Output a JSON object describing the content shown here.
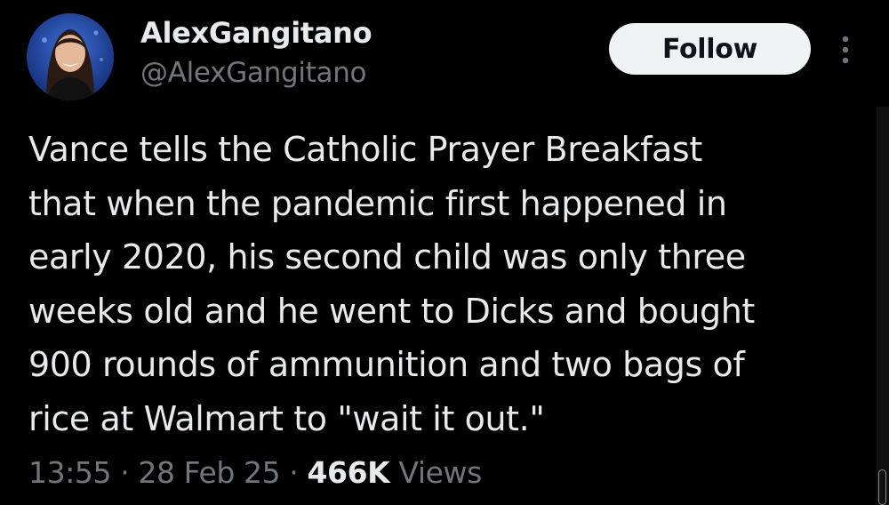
{
  "author": {
    "display_name": "AlexGangitano",
    "handle": "@AlexGangitano",
    "avatar_icon": "profile-photo"
  },
  "follow_button": {
    "label": "Follow"
  },
  "more_icon": "more-vertical-icon",
  "tweet": {
    "lines": [
      "Vance tells the Catholic Prayer Breakfast",
      "that when the pandemic first happened in",
      "early 2020, his second child was only three",
      "weeks old and he went to Dicks and bought",
      "900 rounds of ammunition and two bags of",
      "rice at Walmart to \"wait it out.\""
    ]
  },
  "meta": {
    "time": "13:55",
    "separator": "·",
    "date": "28 Feb 25",
    "views_count": "466K",
    "views_label": "Views"
  },
  "colors": {
    "background": "#000000",
    "primary_text": "#e7e9ea",
    "secondary_text": "#71767b",
    "follow_bg": "#eff3f4",
    "follow_text": "#0f1419"
  }
}
